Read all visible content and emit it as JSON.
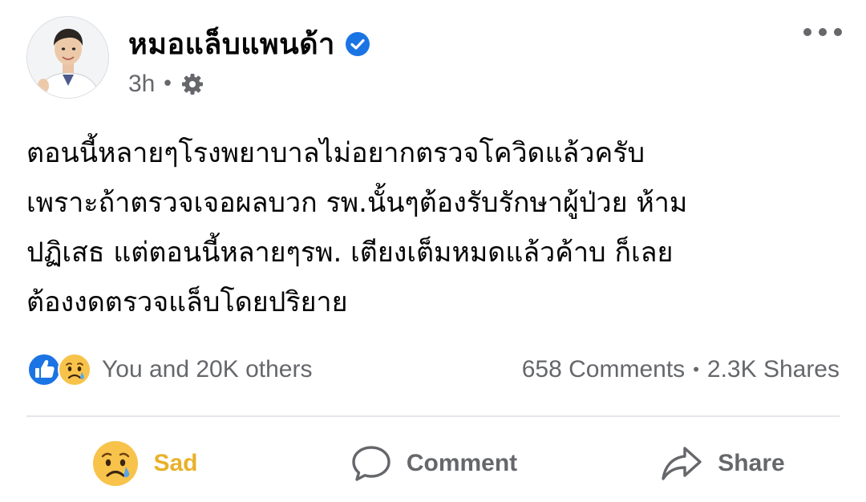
{
  "author": {
    "name": "หมอแล็บแพนด้า",
    "verified": true,
    "verified_color": "#1b74e4"
  },
  "meta": {
    "time": "3h",
    "separator": "•",
    "privacy_icon": "gear-icon"
  },
  "post": {
    "lines": [
      "ตอนนี้หลายๆโรงพยาบาลไม่อยากตรวจโควิดแล้วครับ",
      "เพราะถ้าตรวจเจอผลบวก รพ.นั้นๆต้องรับรักษาผู้ป่วย ห้าม",
      "ปฏิเสธ แต่ตอนนี้หลายๆรพ. เตียงเต็มหมดแล้วค้าบ ก็เลย",
      "ต้องงดตรวจแล็บโดยปริยาย"
    ]
  },
  "stats": {
    "reaction_icons": [
      "like-icon",
      "sad-face-icon"
    ],
    "reactions": "You and 20K others",
    "comments": "658 Comments",
    "separator": "•",
    "shares": "2.3K Shares"
  },
  "actions": {
    "reaction": {
      "label": "Sad",
      "icon": "sad-face-icon",
      "color": "#e9b12a"
    },
    "comment": {
      "label": "Comment",
      "icon": "comment-icon"
    },
    "share": {
      "label": "Share",
      "icon": "share-icon"
    }
  },
  "colors": {
    "secondary_text": "#65676b",
    "primary_text": "#050505",
    "like_blue": "#1b74e4",
    "divider": "#e4e6eb"
  }
}
